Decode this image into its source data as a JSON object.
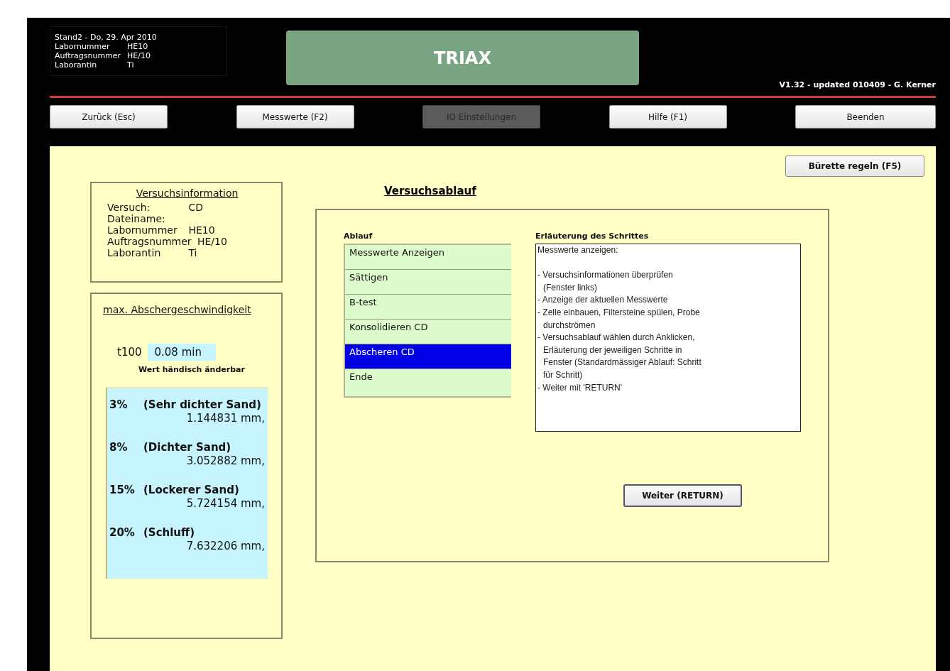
{
  "header": {
    "title_line": "Stand2  -  Do, 29. Apr 2010",
    "fields": [
      {
        "label": "Labornummer",
        "value": "HE10"
      },
      {
        "label": "Auftragsnummer",
        "value": "HE/10"
      },
      {
        "label": "Laborantin",
        "value": "Ti"
      }
    ],
    "app_title": "TRIAX",
    "version": "V1.32 - updated 010409 - G. Kerner"
  },
  "nav_buttons": [
    {
      "label": "Zurück (Esc)",
      "disabled": false
    },
    {
      "label": "Messwerte (F2)",
      "disabled": false
    },
    {
      "label": "IO Einstellungen",
      "disabled": true
    },
    {
      "label": "Hilfe (F1)",
      "disabled": false
    },
    {
      "label": "Beenden",
      "disabled": false
    }
  ],
  "burette_button": "Bürette regeln (F5)",
  "info_panel": {
    "title": "Versuchsinformation",
    "lines": [
      {
        "label": "Versuch:",
        "value": "CD"
      },
      {
        "label": "Dateiname:"
      },
      {
        "label": "Labornummer",
        "value": "HE10"
      },
      {
        "label": "Auftragsnummer",
        "value": "HE/10"
      },
      {
        "label": "Laborantin",
        "value": "Ti"
      }
    ]
  },
  "speed_panel": {
    "title": "max. Abschergeschwindigkeit",
    "t_label": "t100",
    "t_value": "0.08  min",
    "hint": "Wert händisch änderbar",
    "results": [
      {
        "percent": "3%",
        "label": "(Sehr dichter Sand)",
        "value": "1.144831  mm,"
      },
      {
        "percent": "8%",
        "label": "(Dichter Sand)",
        "value": "3.052882  mm,"
      },
      {
        "percent": "15%",
        "label": "(Lockerer Sand)",
        "value": "5.724154  mm,"
      },
      {
        "percent": "20%",
        "label": "(Schluff)",
        "value": "7.632206  mm,"
      }
    ]
  },
  "procedure": {
    "title": "Versuchsablauf",
    "list_label": "Ablauf",
    "steps": [
      {
        "label": "Messwerte Anzeigen",
        "selected": false
      },
      {
        "label": "Sättigen",
        "selected": false
      },
      {
        "label": "B-test",
        "selected": false
      },
      {
        "label": "Konsolidieren CD",
        "selected": false
      },
      {
        "label": "Abscheren CD",
        "selected": true
      },
      {
        "label": "Ende",
        "selected": false
      }
    ],
    "explanation_label": "Erläuterung des Schrittes",
    "explanation_heading": "Messwerte anzeigen:",
    "explanation_bullets": [
      {
        "lines": [
          "- Versuchsinformationen überprüfen",
          "(Fenster links)"
        ]
      },
      {
        "lines": [
          "- Anzeige der aktuellen Messwerte"
        ]
      },
      {
        "lines": [
          "- Zelle einbauen, Filtersteine spülen, Probe",
          "durchströmen"
        ]
      },
      {
        "lines": [
          "- Versuchsablauf wählen durch Anklicken,",
          "Erläuterung der jeweiligen Schritte in",
          "Fenster (Standardmässiger Ablauf: Schritt",
          "für Schritt)"
        ]
      },
      {
        "lines": [
          "- Weiter mit 'RETURN'"
        ]
      }
    ],
    "next_button": "Weiter (RETURN)"
  }
}
